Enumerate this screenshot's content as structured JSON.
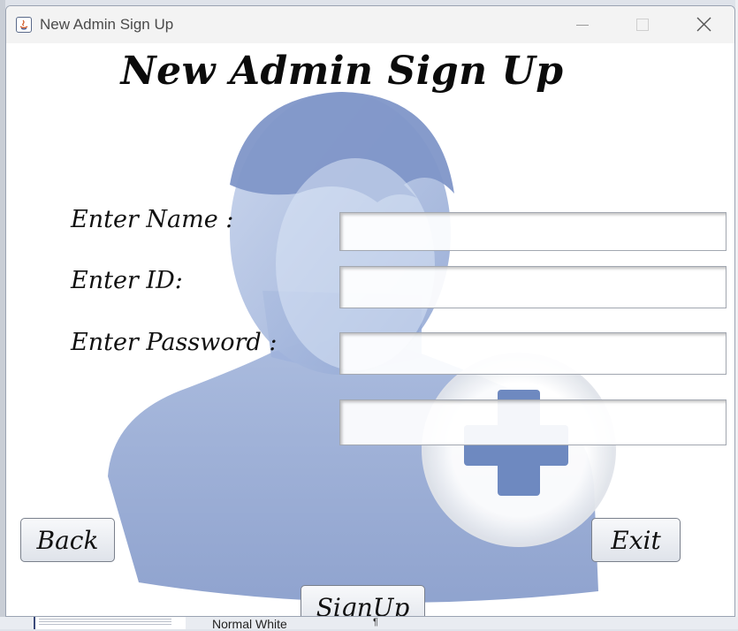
{
  "window": {
    "title": "New Admin Sign Up",
    "controls": [
      "minimize-icon",
      "maximize-icon",
      "close-icon"
    ]
  },
  "form": {
    "heading": "New Admin Sign Up",
    "name_label": "Enter Name :",
    "id_label": "Enter ID:",
    "password_label": "Enter Password :",
    "name_value": "",
    "id_value": "",
    "password_value": "",
    "extra_value": ""
  },
  "buttons": {
    "back": "Back",
    "exit": "Exit",
    "signup": "SignUp"
  },
  "background_app": {
    "style_name": "Normal White",
    "pilcrow": "¶"
  },
  "colors": {
    "avatar": "#8fa3cf",
    "avatar_shadow": "#6d83b8",
    "plus": "#6e89c0"
  }
}
